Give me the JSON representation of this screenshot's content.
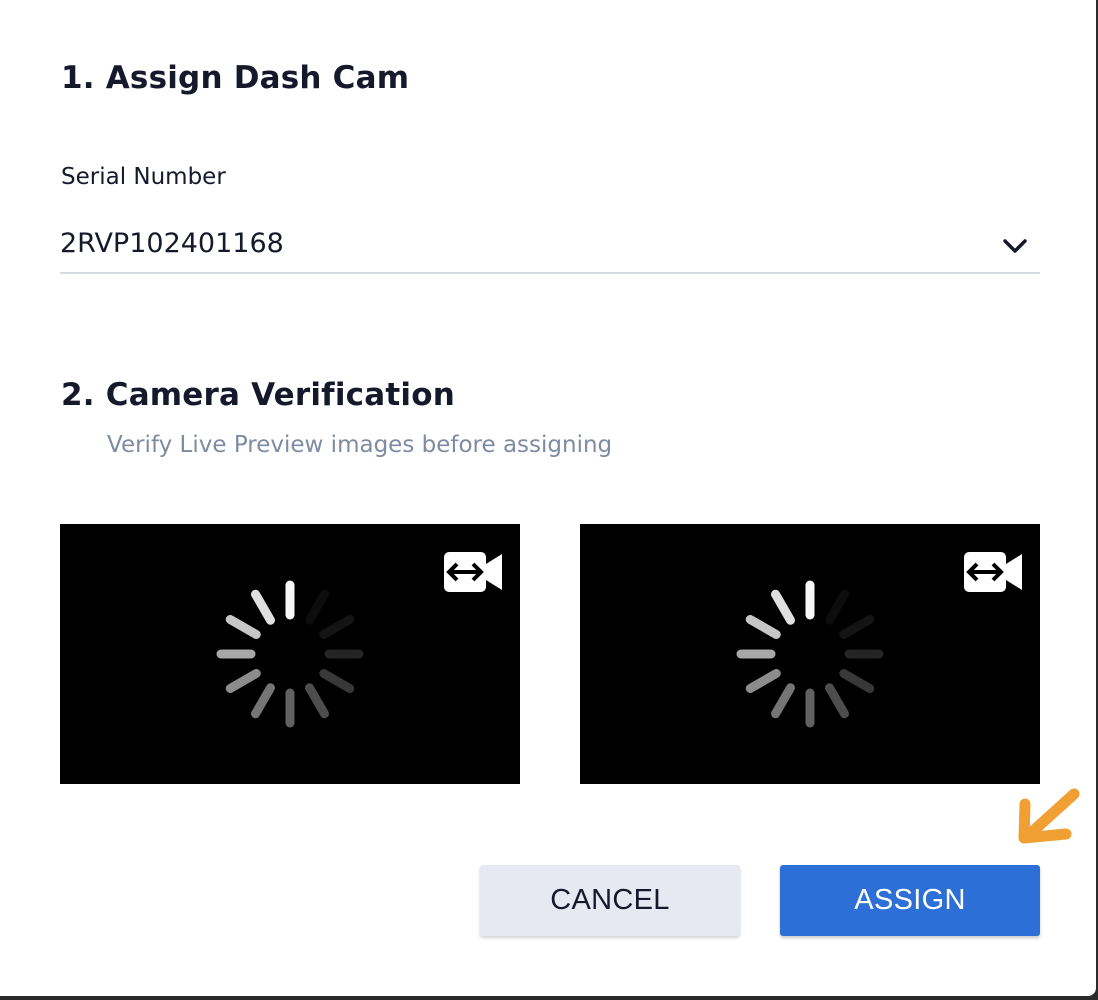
{
  "dialog": {
    "section1": {
      "title": "1. Assign Dash Cam"
    },
    "serial": {
      "label": "Serial Number",
      "value": "2RVP102401168",
      "dropdown_icon": "chevron-down-icon"
    },
    "section2": {
      "title": "2. Camera Verification",
      "subtitle": "Verify Live Preview images before assigning"
    },
    "previews": [
      {
        "status": "loading",
        "spinner_icon": "loading-spinner-icon",
        "switch_icon": "switch-camera-icon"
      },
      {
        "status": "loading",
        "spinner_icon": "loading-spinner-icon",
        "switch_icon": "switch-camera-icon"
      }
    ],
    "actions": {
      "cancel_label": "CANCEL",
      "assign_label": "ASSIGN"
    }
  },
  "colors": {
    "title_text": "#16192b",
    "subtitle_text": "#7e8ba0",
    "primary_button": "#2c6fd6",
    "secondary_button": "#e6e9f1",
    "preview_background": "#000000",
    "annotation_arrow": "#f0a033"
  },
  "annotation": {
    "icon": "pointer-arrow-icon",
    "points_to": "assign-button"
  }
}
